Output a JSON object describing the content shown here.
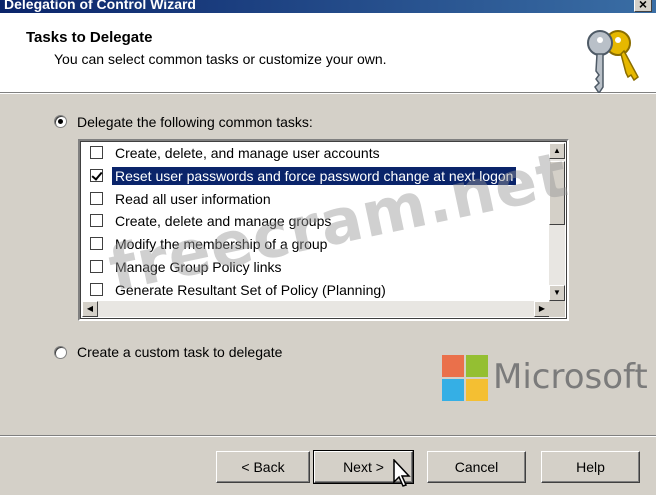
{
  "window": {
    "title": "Delegation of Control Wizard",
    "close_glyph": "×"
  },
  "header": {
    "title": "Tasks to Delegate",
    "subtitle": "You can select common tasks or customize your own.",
    "icon": "keys-icon"
  },
  "options": {
    "common": {
      "label": "Delegate the following common tasks:",
      "selected": true
    },
    "custom": {
      "label": "Create a custom task to delegate",
      "selected": false
    }
  },
  "tasks": [
    {
      "label": "Create, delete, and manage user accounts",
      "checked": false
    },
    {
      "label": "Reset user passwords and force password change at next logon",
      "checked": true,
      "selected": true
    },
    {
      "label": "Read all user information",
      "checked": false
    },
    {
      "label": "Create, delete and manage groups",
      "checked": false
    },
    {
      "label": "Modify the membership of a group",
      "checked": false
    },
    {
      "label": "Manage Group Policy links",
      "checked": false
    },
    {
      "label": "Generate Resultant Set of Policy (Planning)",
      "checked": false
    }
  ],
  "buttons": {
    "back": "< Back",
    "next": "Next >",
    "cancel": "Cancel",
    "help": "Help"
  },
  "watermark": {
    "site": "freecram.net",
    "brand": "Microsoft"
  },
  "colors": {
    "accent": "#0a246a",
    "dialog_bg": "#d4d0c8"
  }
}
